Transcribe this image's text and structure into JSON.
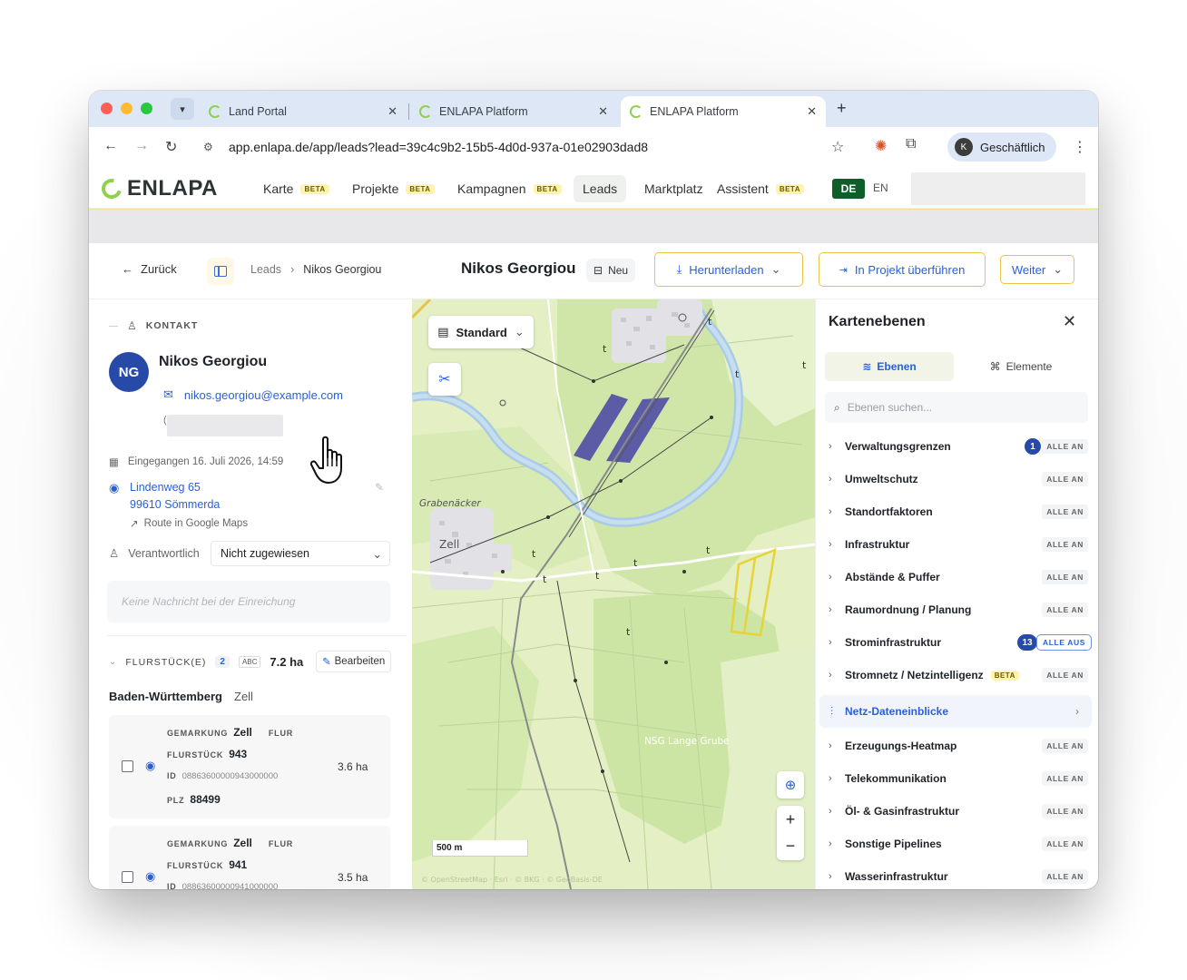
{
  "browser": {
    "tabs": [
      {
        "label": "Land Portal"
      },
      {
        "label": "ENLAPA Platform"
      },
      {
        "label": "ENLAPA Platform"
      }
    ],
    "tab_close": "✕",
    "new_tab": "+",
    "url": "app.enlapa.de/app/leads?lead=39c4c9b2-15b5-4d0d-937a-01e02903dad8",
    "profile_initial": "K",
    "profile_label": "Geschäftlich"
  },
  "app": {
    "brand": "ENLAPA",
    "nav": [
      {
        "label": "Karte",
        "badge": "BETA"
      },
      {
        "label": "Projekte",
        "badge": "BETA"
      },
      {
        "label": "Kampagnen",
        "badge": "BETA"
      },
      {
        "label": "Leads",
        "badge": ""
      },
      {
        "label": "Marktplatz",
        "badge": ""
      },
      {
        "label": "Assistent",
        "badge": "BETA"
      }
    ],
    "lang_de": "DE",
    "lang_en": "EN"
  },
  "pagehead": {
    "back_label": "Zurück",
    "breadcrumb_root": "Leads",
    "breadcrumb_current": "Nikos Georgiou",
    "title": "Nikos Georgiou",
    "status": "Neu",
    "download_label": "Herunterladen",
    "transfer_label": "In Projekt überführen",
    "more_label": "Weiter"
  },
  "contact": {
    "section_label": "KONTAKT",
    "initials": "NG",
    "name": "Nikos Georgiou",
    "email": "nikos.georgiou@example.com",
    "phone_prefix": "(",
    "received": "Eingegangen 16. Juli 2026, 14:59",
    "street": "Lindenweg 65",
    "city": "99610 Sömmerda",
    "route_label": "Route in Google Maps",
    "responsible_label": "Verantwortlich",
    "responsible_value": "Nicht zugewiesen",
    "message_placeholder": "Keine Nachricht bei der Einreichung"
  },
  "plots": {
    "section_label": "FLURSTÜCK(E)",
    "count": "2",
    "abc": "ABC",
    "area_total": "7.2 ha",
    "edit_label": "Bearbeiten",
    "state": "Baden-Württemberg",
    "municipality": "Zell",
    "key_gemarkung": "GEMARKUNG",
    "key_flur": "FLUR",
    "key_flurstueck": "FLURSTÜCK",
    "key_id": "ID",
    "key_plz": "PLZ",
    "items": [
      {
        "gemarkung": "Zell",
        "flurstueck": "943",
        "id": "08863600000943000000",
        "plz": "88499",
        "area": "3.6 ha"
      },
      {
        "gemarkung": "Zell",
        "flurstueck": "941",
        "id": "08863600000941000000",
        "plz": "",
        "area": "3.5 ha"
      }
    ]
  },
  "map": {
    "basemap_label": "Standard",
    "scale_label": "500 m",
    "place_grabenaecker": "Grabenäcker",
    "place_zell": "Zell",
    "place_nsg": "NSG Lange Grube",
    "attribution": "© OpenStreetMap · Esri · © BKG · © GeoBasis-DE"
  },
  "layers_panel": {
    "title": "Kartenebenen",
    "tab_layers": "Ebenen",
    "tab_elements": "Elemente",
    "search_placeholder": "Ebenen suchen...",
    "layers": [
      {
        "name": "Verwaltungsgrenzen",
        "count": "1",
        "toggle": "ALLE AN"
      },
      {
        "name": "Umweltschutz",
        "count": "",
        "toggle": "ALLE AN"
      },
      {
        "name": "Standortfaktoren",
        "count": "",
        "toggle": "ALLE AN"
      },
      {
        "name": "Infrastruktur",
        "count": "",
        "toggle": "ALLE AN"
      },
      {
        "name": "Abstände & Puffer",
        "count": "",
        "toggle": "ALLE AN"
      },
      {
        "name": "Raumordnung / Planung",
        "count": "",
        "toggle": "ALLE AN"
      },
      {
        "name": "Strominfrastruktur",
        "count": "13",
        "toggle": "ALLE AUS"
      },
      {
        "name": "Stromnetz / Netzintelligenz",
        "badge": "BETA",
        "count": "",
        "toggle": "ALLE AN"
      }
    ],
    "highlight_label": "Netz-Dateneinblicke",
    "layers_below": [
      {
        "name": "Erzeugungs-Heatmap",
        "toggle": "ALLE AN"
      },
      {
        "name": "Telekommunikation",
        "toggle": "ALLE AN"
      },
      {
        "name": "Öl- & Gasinfrastruktur",
        "toggle": "ALLE AN"
      },
      {
        "name": "Sonstige Pipelines",
        "toggle": "ALLE AN"
      },
      {
        "name": "Wasserinfrastruktur",
        "toggle": "ALLE AN"
      }
    ]
  },
  "colors": {
    "brand_green": "#8fd14f",
    "accent_blue": "#2b5fd9",
    "avatar_blue": "#2749a8",
    "button_border": "#e8c547"
  }
}
